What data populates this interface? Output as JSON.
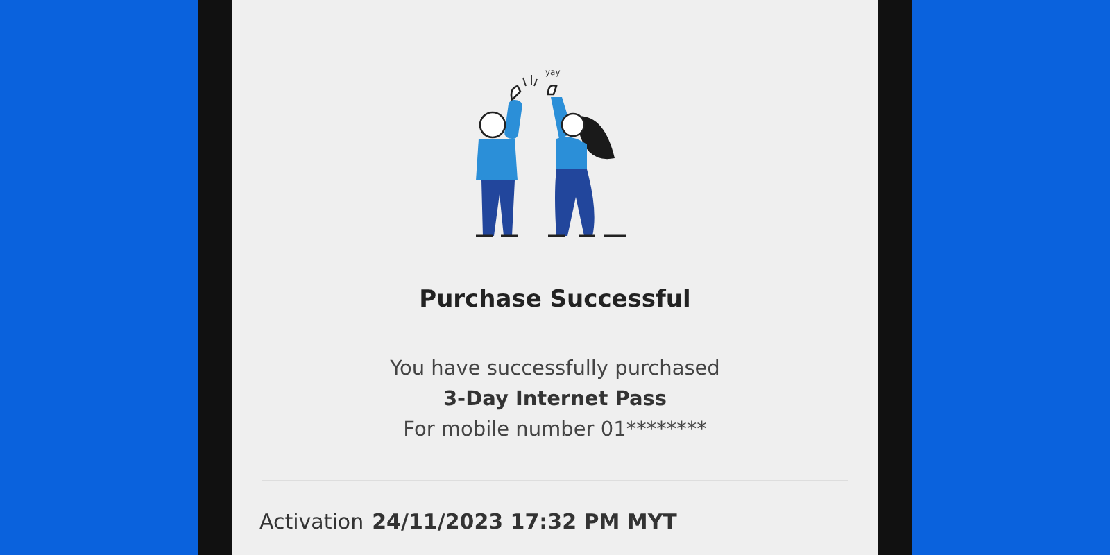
{
  "illustration": {
    "caption": "yay"
  },
  "title": "Purchase Successful",
  "message": {
    "line": "You have successfully purchased",
    "product": "3-Day Internet Pass",
    "mobile": "For mobile number 01********"
  },
  "details": [
    {
      "label": "Activation",
      "value": "24/11/2023 17:32 PM MYT"
    }
  ]
}
